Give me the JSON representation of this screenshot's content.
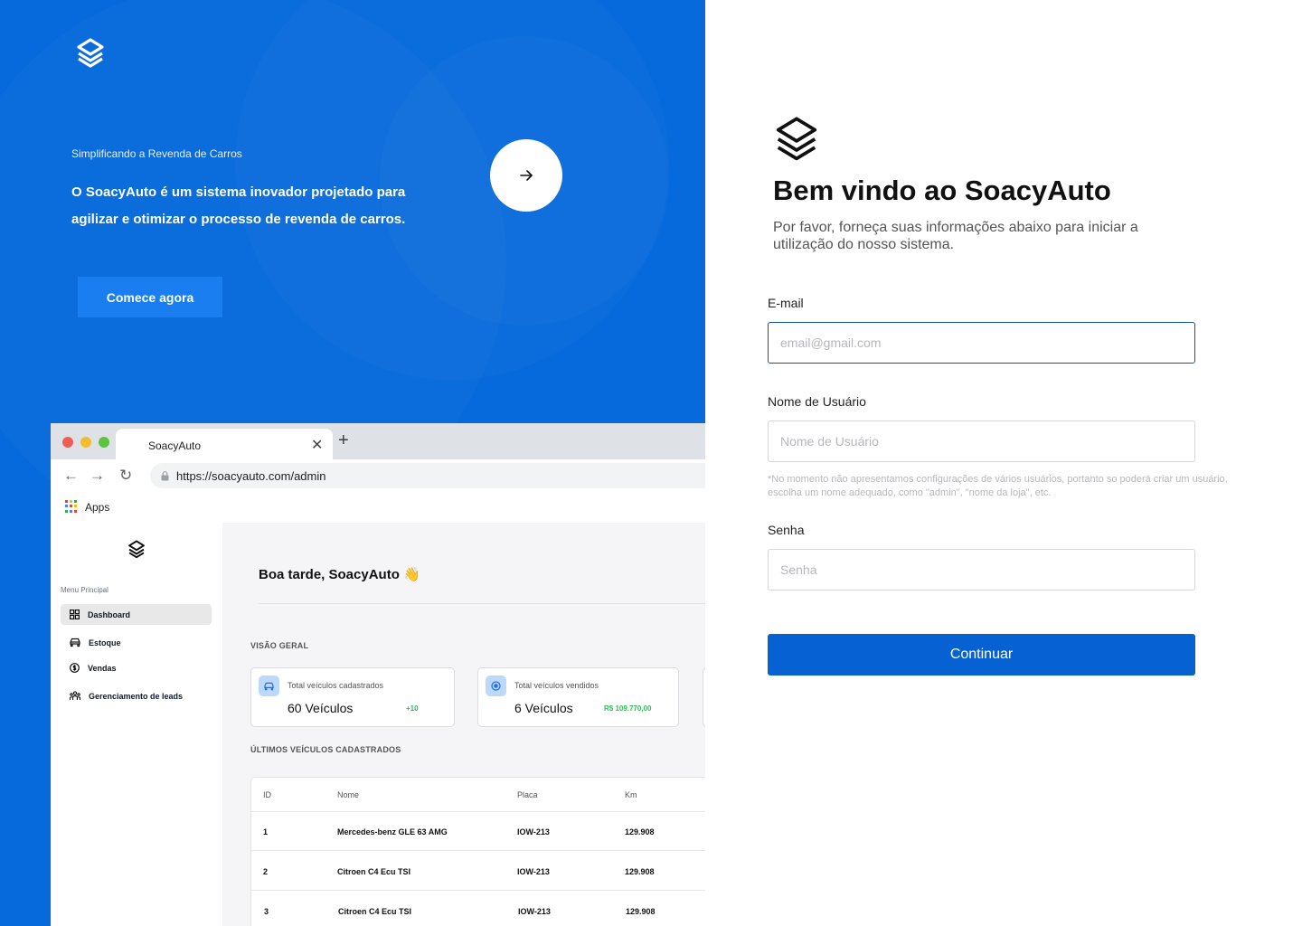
{
  "colors": {
    "hero_blue": "#0669dc",
    "cta_blue": "#1a7ef0",
    "primary_button": "#0661d3",
    "success_green": "#2fbf52"
  },
  "hero": {
    "logo_icon": "layers-icon",
    "tagline": "Simplificando a Revenda de Carros",
    "description": "O SoacyAuto é um sistema inovador projetado para agilizar e otimizar o processo de revenda de carros.",
    "cta_label": "Comece agora",
    "arrow_icon": "arrow-right-icon"
  },
  "browser": {
    "tab_title": "SoacyAuto",
    "url": "https://soacyauto.com/admin",
    "bookmark_label": "Apps",
    "sidebar": {
      "menu_title": "Menu Principal",
      "items": [
        {
          "label": "Dashboard",
          "icon": "grid-icon",
          "active": true
        },
        {
          "label": "Estoque",
          "icon": "car-icon",
          "active": false
        },
        {
          "label": "Vendas",
          "icon": "coin-icon",
          "active": false
        },
        {
          "label": "Gerenciamento de leads",
          "icon": "users-icon",
          "active": false
        }
      ]
    },
    "main": {
      "greeting": "Boa tarde, SoacyAuto 👋",
      "overview_title": "VISÃO GERAL",
      "cards": [
        {
          "label": "Total veículos cadastrados",
          "value": "60 Veículos",
          "delta": "+10",
          "icon": "car-icon"
        },
        {
          "label": "Total veículos vendidos",
          "value": "6 Veículos",
          "delta": "R$ 109.770,00",
          "icon": "coin-icon"
        }
      ],
      "recent_title": "ÚLTIMOS VEÍCULOS CADASTRADOS",
      "table": {
        "columns": [
          "ID",
          "Nome",
          "Placa",
          "Km"
        ],
        "rows": [
          [
            "1",
            "Mercedes-benz GLE 63 AMG",
            "IOW-213",
            "129.908"
          ],
          [
            "2",
            "Citroen C4 Ecu TSI",
            "IOW-213",
            "129.908"
          ],
          [
            "3",
            "Citroen C4 Ecu TSI",
            "IOW-213",
            "129.908"
          ]
        ]
      }
    }
  },
  "login": {
    "logo_icon": "layers-icon",
    "title": "Bem vindo ao SoacyAuto",
    "subtitle": "Por favor, forneça suas informações abaixo para iniciar a utilização do nosso sistema.",
    "email_label": "E-mail",
    "email_placeholder": "email@gmail.com",
    "email_value": "",
    "username_label": "Nome de Usuário",
    "username_placeholder": "Nome de Usuário",
    "username_value": "",
    "username_note": "*No momento não apresentamos configurações de vários usuários, portanto so poderá criar um usuário, escolha um nome adequado, como \"admin\", \"nome da loja\", etc.",
    "password_label": "Senha",
    "password_placeholder": "Senha",
    "password_value": "",
    "submit_label": "Continuar"
  }
}
